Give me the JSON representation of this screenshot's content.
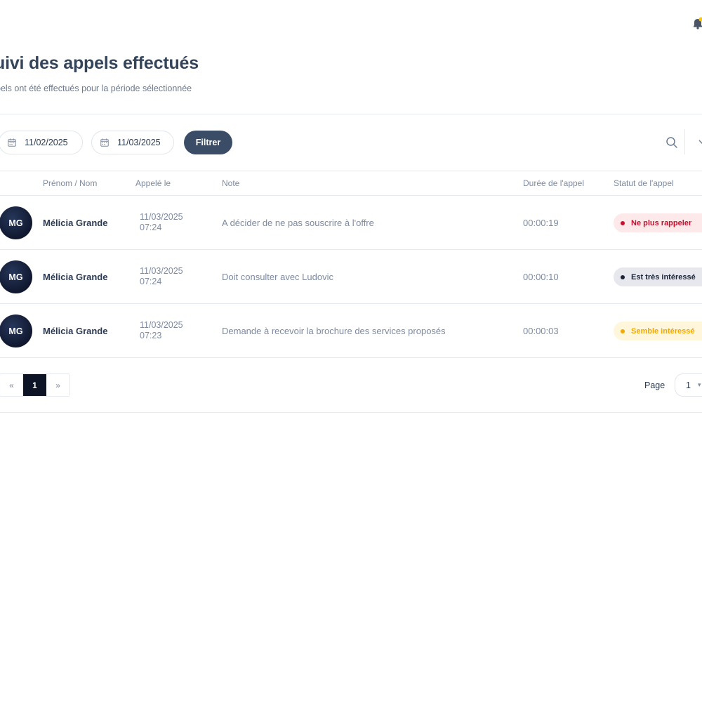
{
  "header": {
    "title": "uivi des appels effectués",
    "subtitle": "pels ont été effectués pour la période sélectionnée"
  },
  "filters": {
    "date_from": "11/02/2025",
    "date_to": "11/03/2025",
    "filter_label": "Filtrer"
  },
  "table": {
    "columns": [
      "Prénom / Nom",
      "Appelé le",
      "Note",
      "Durée de l'appel",
      "Statut de l'appel"
    ],
    "rows": [
      {
        "initials": "MG",
        "name": "Mélicia Grande",
        "date": "11/03/2025",
        "time": "07:24",
        "note": "A décider de ne pas souscrire à l'offre",
        "duration": "00:00:19",
        "status": "Ne plus rappeler"
      },
      {
        "initials": "MG",
        "name": "Mélicia Grande",
        "date": "11/03/2025",
        "time": "07:24",
        "note": "Doit consulter avec Ludovic",
        "duration": "00:00:10",
        "status": "Est très intéressé"
      },
      {
        "initials": "MG",
        "name": "Mélicia Grande",
        "date": "11/03/2025",
        "time": "07:23",
        "note": "Demande à recevoir la brochure des services proposés",
        "duration": "00:00:03",
        "status": "Semble intéressé"
      }
    ]
  },
  "status_colors": {
    "ne_plus_rappeler": {
      "bg": "#fde8ea",
      "fg": "#c8102e"
    },
    "est_tres_interesse": {
      "bg": "#e6e8ee",
      "fg": "#1c2438"
    },
    "semble_interesse": {
      "bg": "#fff6dc",
      "fg": "#f2a900"
    }
  },
  "pagination": {
    "prev": "«",
    "current": "1",
    "next": "»",
    "page_label": "Page",
    "page_value": "1"
  },
  "icons": [
    "bell-icon",
    "calendar-icon",
    "search-icon",
    "chevron-down-icon"
  ]
}
